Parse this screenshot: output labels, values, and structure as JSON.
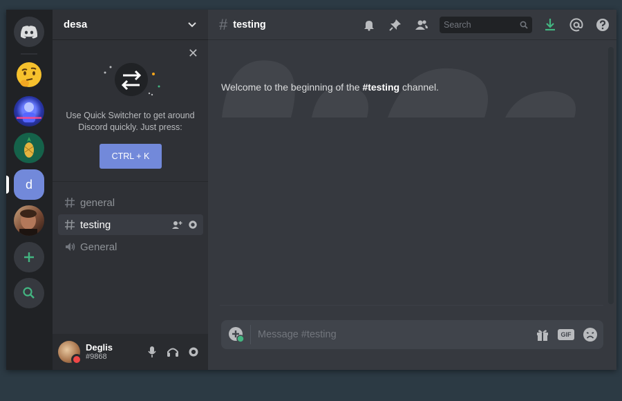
{
  "guild": {
    "name": "desa"
  },
  "rail": {
    "server_initial": "d"
  },
  "quick_switcher": {
    "text": "Use Quick Switcher to get around Discord quickly. Just press:",
    "shortcut": "CTRL + K"
  },
  "channels": [
    {
      "name": "general",
      "type": "text",
      "active": false
    },
    {
      "name": "testing",
      "type": "text",
      "active": true
    },
    {
      "name": "General",
      "type": "voice",
      "active": false
    }
  ],
  "user": {
    "name": "Deglis",
    "tag": "#9868",
    "status": "dnd"
  },
  "header": {
    "channel": "testing",
    "search_placeholder": "Search"
  },
  "welcome": {
    "prefix": "Welcome to the beginning of the ",
    "channel": "#testing",
    "suffix": " channel."
  },
  "composer": {
    "placeholder": "Message #testing",
    "gif_label": "GIF"
  },
  "colors": {
    "accent": "#7289da",
    "green": "#43b581",
    "dnd": "#f04747"
  }
}
